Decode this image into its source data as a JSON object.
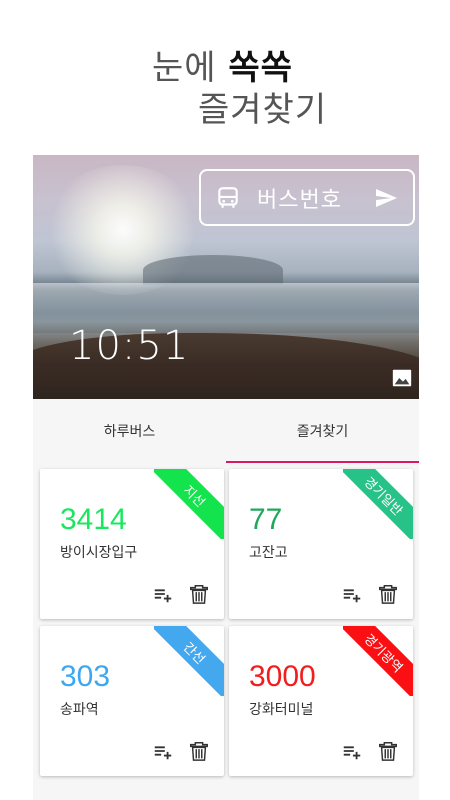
{
  "headline": {
    "line1_prefix": "눈에 ",
    "line1_emphasis": "쏙쏙",
    "line2": "즐겨찾기"
  },
  "hero": {
    "search_label": "버스번호",
    "time": "10:51"
  },
  "tabs": [
    {
      "label": "하루버스",
      "active": false
    },
    {
      "label": "즐겨찾기",
      "active": true
    }
  ],
  "favorites": [
    {
      "number": "3414",
      "stop": "방이시장입구",
      "type": "지선",
      "color": "#19e85f",
      "ribbon": "#13e34c"
    },
    {
      "number": "77",
      "stop": "고잔고",
      "type": "경기일반",
      "color": "#1ea85a",
      "ribbon": "#27c287"
    },
    {
      "number": "303",
      "stop": "송파역",
      "type": "간선",
      "color": "#3ea8ef",
      "ribbon": "#44a8ee"
    },
    {
      "number": "3000",
      "stop": "강화터미널",
      "type": "경기광역",
      "color": "#f21d1d",
      "ribbon": "#fa0f12"
    }
  ],
  "icons": {
    "bus": "bus-icon",
    "send": "send-icon",
    "image": "image-icon",
    "add_list": "playlist-add-icon",
    "delete": "trash-icon"
  }
}
